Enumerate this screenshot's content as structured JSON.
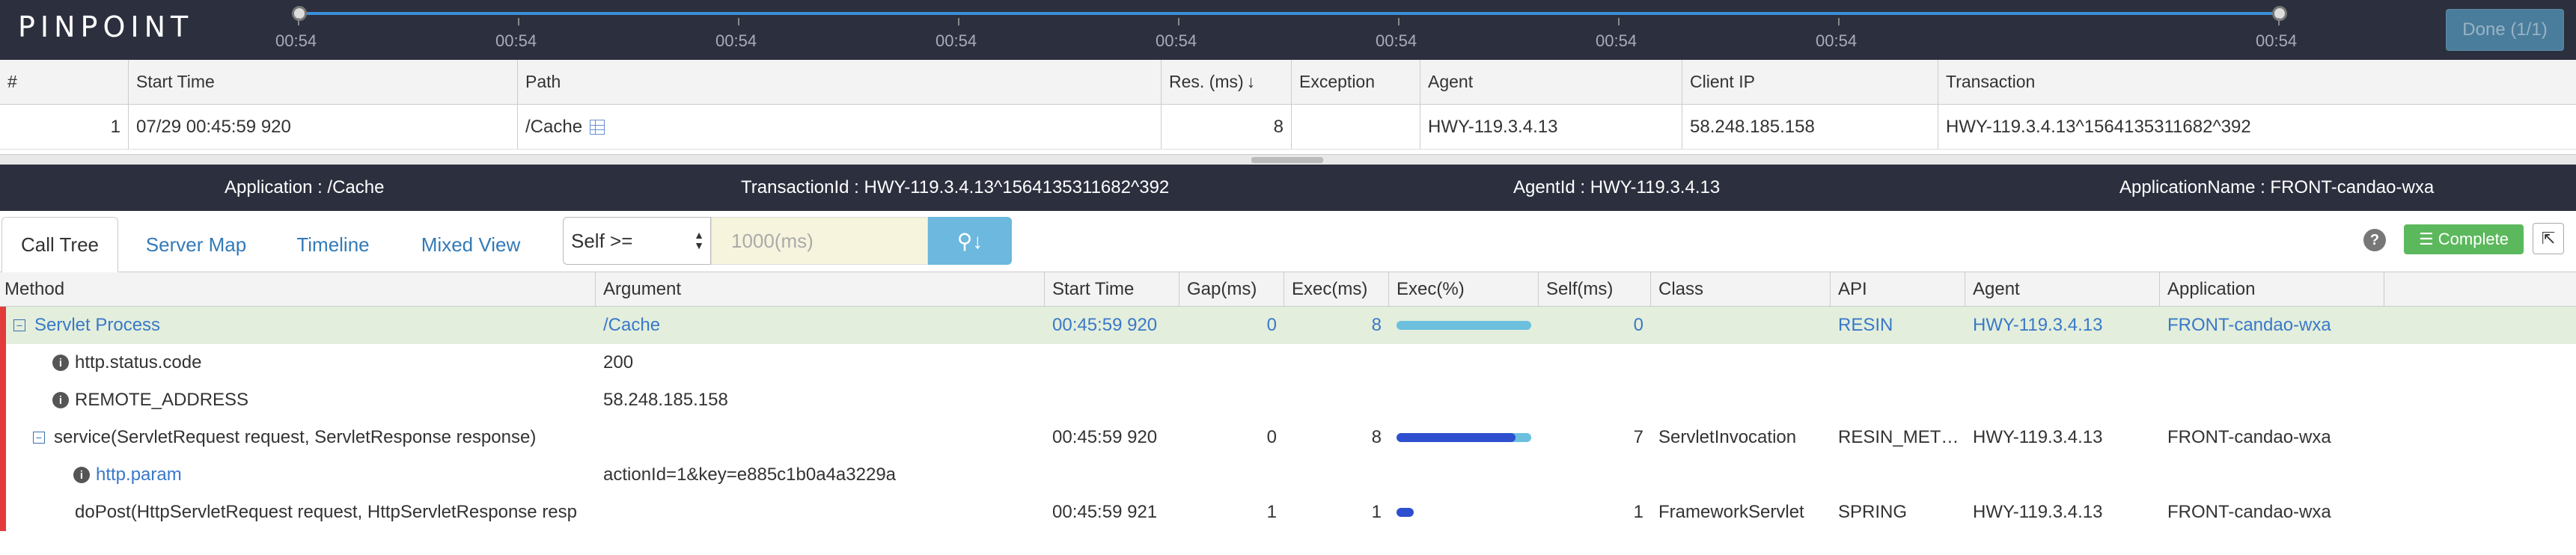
{
  "app": {
    "logo": "PINPOINT"
  },
  "timeline": {
    "ticks": [
      "00:54",
      "00:54",
      "00:54",
      "00:54",
      "00:54",
      "00:54",
      "00:54",
      "00:54",
      "00:54"
    ],
    "track_color": "#3a8fd8"
  },
  "done_button": "Done (1/1)",
  "transactions": {
    "headers": [
      "#",
      "Start Time",
      "Path",
      "Res. (ms)",
      "Exception",
      "Agent",
      "Client IP",
      "Transaction"
    ],
    "sort_icon": "arrow-down-icon",
    "rows": [
      {
        "num": "1",
        "start_time": "07/29 00:45:59 920",
        "path": "/Cache",
        "res_ms": "8",
        "exception": "",
        "agent": "HWY-119.3.4.13",
        "client_ip": "58.248.185.158",
        "transaction": "HWY-119.3.4.13^1564135311682^392"
      }
    ]
  },
  "info": {
    "application": "Application : /Cache",
    "transaction_id": "TransactionId : HWY-119.3.4.13^1564135311682^392",
    "agent_id": "AgentId : HWY-119.3.4.13",
    "application_name": "ApplicationName : FRONT-candao-wxa"
  },
  "tabs": [
    "Call Tree",
    "Server Map",
    "Timeline",
    "Mixed View"
  ],
  "filter": {
    "select_value": "Self >=",
    "input_placeholder": "1000(ms)"
  },
  "toolbar": {
    "help": "?",
    "complete": "Complete"
  },
  "calltree": {
    "headers": [
      "Method",
      "Argument",
      "Start Time",
      "Gap(ms)",
      "Exec(ms)",
      "Exec(%)",
      "Self(ms)",
      "Class",
      "API",
      "Agent",
      "Application"
    ],
    "rows": [
      {
        "method": "Servlet Process",
        "argument": "/Cache",
        "start": "00:45:59 920",
        "gap": "0",
        "exec": "8",
        "pct": 1.0,
        "self_pct": 0.0,
        "self": "0",
        "class": "",
        "api": "RESIN",
        "agent": "HWY-119.3.4.13",
        "app": "FRONT-candao-wxa"
      },
      {
        "method": "http.status.code",
        "argument": "200",
        "start": "",
        "gap": "",
        "exec": "",
        "self": "",
        "class": "",
        "api": "",
        "agent": "",
        "app": ""
      },
      {
        "method": "REMOTE_ADDRESS",
        "argument": "58.248.185.158",
        "start": "",
        "gap": "",
        "exec": "",
        "self": "",
        "class": "",
        "api": "",
        "agent": "",
        "app": ""
      },
      {
        "method": "service(ServletRequest request, ServletResponse response)",
        "argument": "",
        "start": "00:45:59 920",
        "gap": "0",
        "exec": "8",
        "pct": 1.0,
        "self_pct": 0.875,
        "self": "7",
        "class": "ServletInvocation",
        "api": "RESIN_MET…",
        "agent": "HWY-119.3.4.13",
        "app": "FRONT-candao-wxa"
      },
      {
        "method": "http.param",
        "argument": "actionId=1&key=e885c1b0a4a3229a",
        "start": "",
        "gap": "",
        "exec": "",
        "self": "",
        "class": "",
        "api": "",
        "agent": "",
        "app": ""
      },
      {
        "method": "doPost(HttpServletRequest request, HttpServletResponse resp",
        "argument": "",
        "start": "00:45:59 921",
        "gap": "1",
        "exec": "1",
        "pct": 0.125,
        "self_pct": 0.125,
        "self": "1",
        "class": "FrameworkServlet",
        "api": "SPRING",
        "agent": "HWY-119.3.4.13",
        "app": "FRONT-candao-wxa"
      }
    ]
  }
}
